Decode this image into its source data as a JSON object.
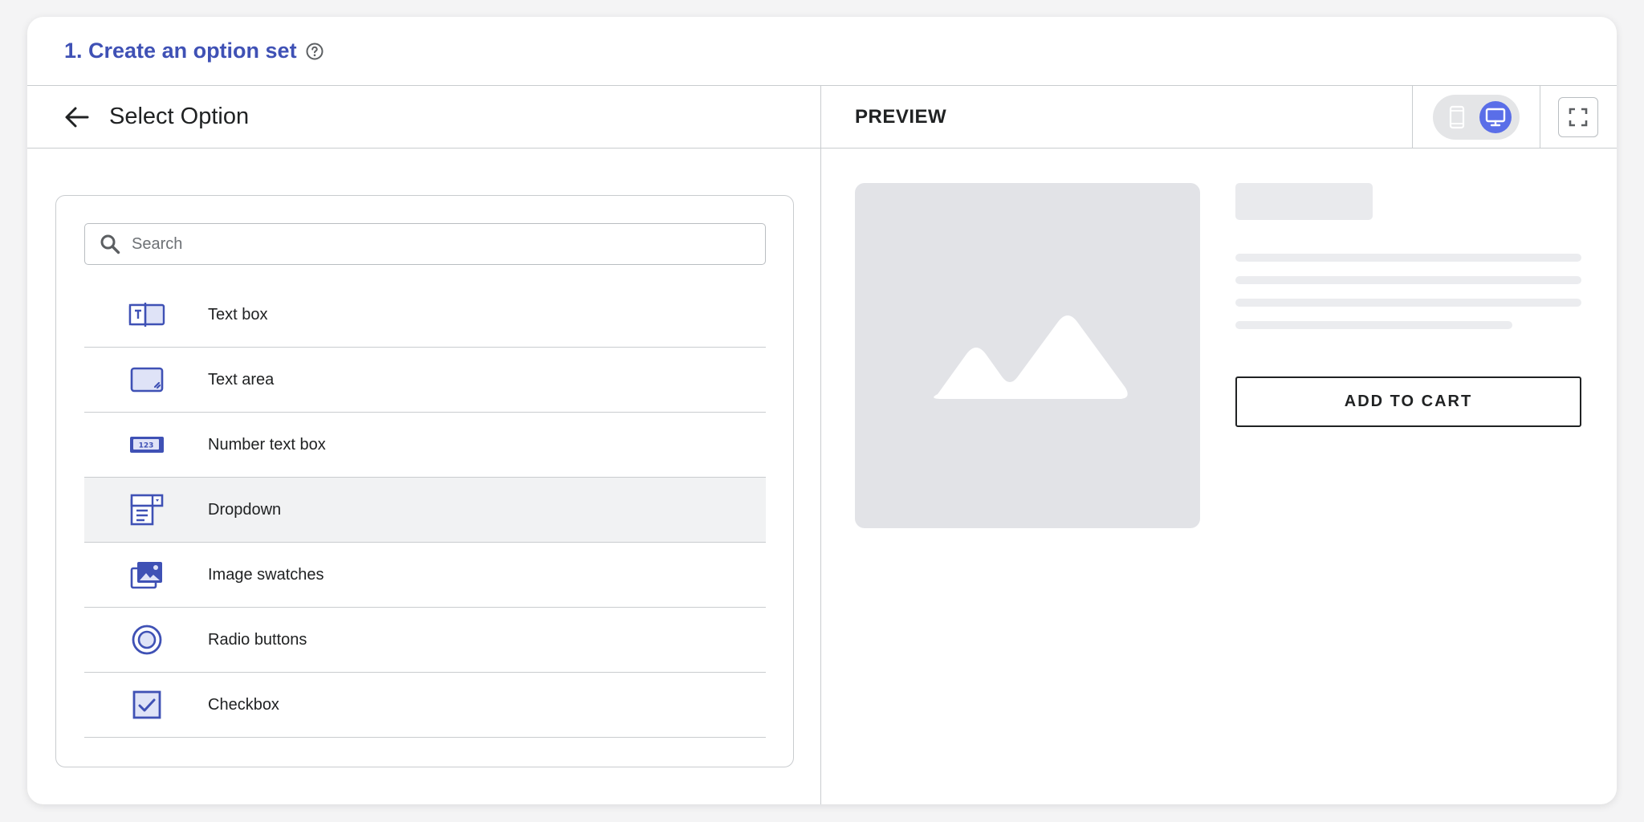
{
  "header": {
    "title": "1. Create an option set",
    "help_icon": "question-circle-icon"
  },
  "left_pane": {
    "back_icon": "arrow-left-icon",
    "title": "Select Option",
    "search": {
      "placeholder": "Search",
      "value": ""
    },
    "options": [
      {
        "label": "Text box",
        "icon": "text-box-icon"
      },
      {
        "label": "Text area",
        "icon": "text-area-icon"
      },
      {
        "label": "Number text box",
        "icon": "number-text-box-icon"
      },
      {
        "label": "Dropdown",
        "icon": "dropdown-icon",
        "selected": true
      },
      {
        "label": "Image swatches",
        "icon": "image-swatches-icon"
      },
      {
        "label": "Radio buttons",
        "icon": "radio-buttons-icon"
      },
      {
        "label": "Checkbox",
        "icon": "checkbox-icon"
      }
    ]
  },
  "preview": {
    "title": "PREVIEW",
    "device_mode": "desktop",
    "add_to_cart_label": "ADD TO CART"
  },
  "colors": {
    "accent": "#3f51b5",
    "toggle_active": "#5a6ee8",
    "placeholder_bg": "#e2e3e7",
    "selected_row_bg": "#f1f2f3"
  }
}
